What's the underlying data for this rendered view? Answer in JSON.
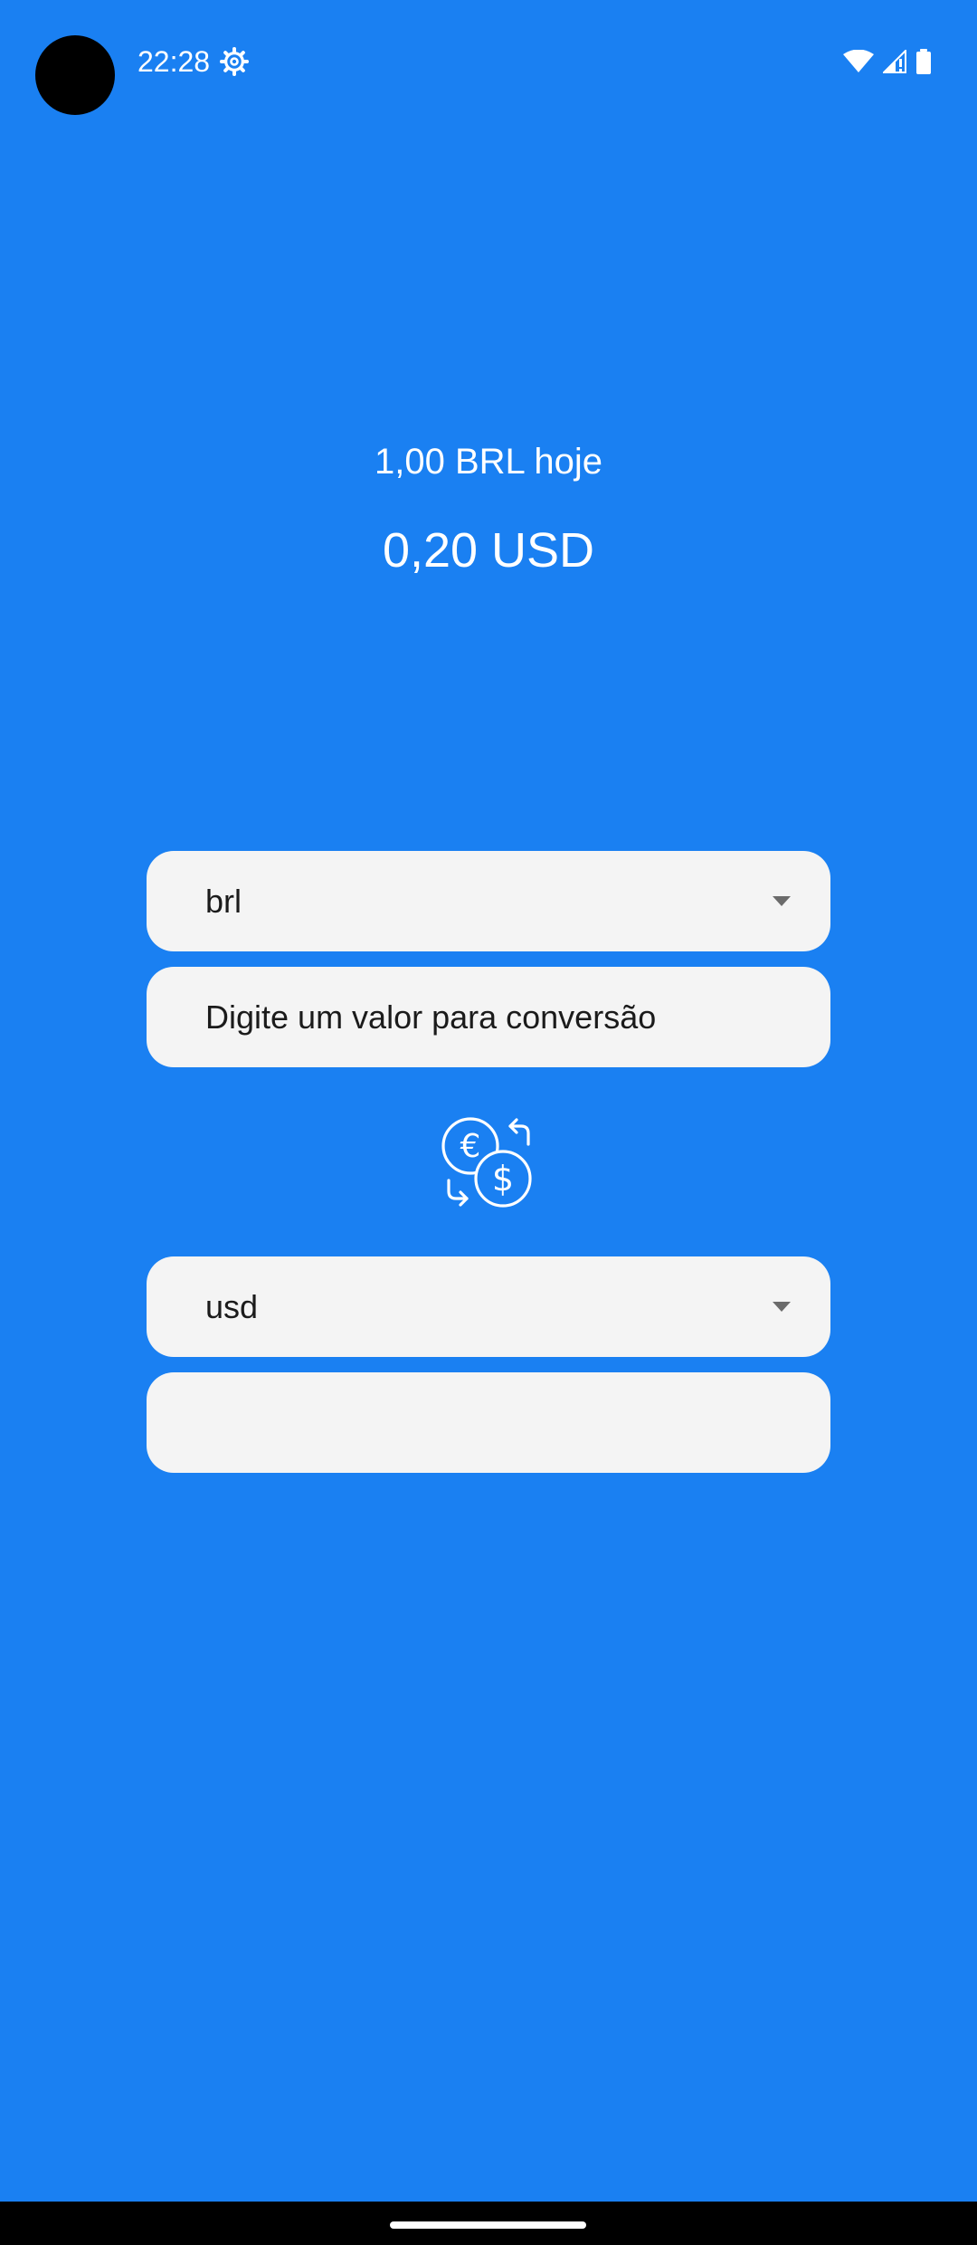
{
  "status_bar": {
    "time": "22:28",
    "icons": [
      "settings-gear-icon",
      "wifi-icon",
      "cell-signal-icon",
      "battery-icon"
    ]
  },
  "rate": {
    "caption": "1,00 BRL hoje",
    "value": "0,20 USD"
  },
  "from": {
    "currency_selected": "brl",
    "amount_placeholder": "Digite um valor para conversão"
  },
  "to": {
    "currency_selected": "usd",
    "amount_value": ""
  },
  "swap_icon": "currency-exchange-icon",
  "colors": {
    "background": "#1A80F2",
    "field_background": "#F4F4F4",
    "text_on_background": "#FFFFFF",
    "field_text": "#1B1B1B"
  }
}
